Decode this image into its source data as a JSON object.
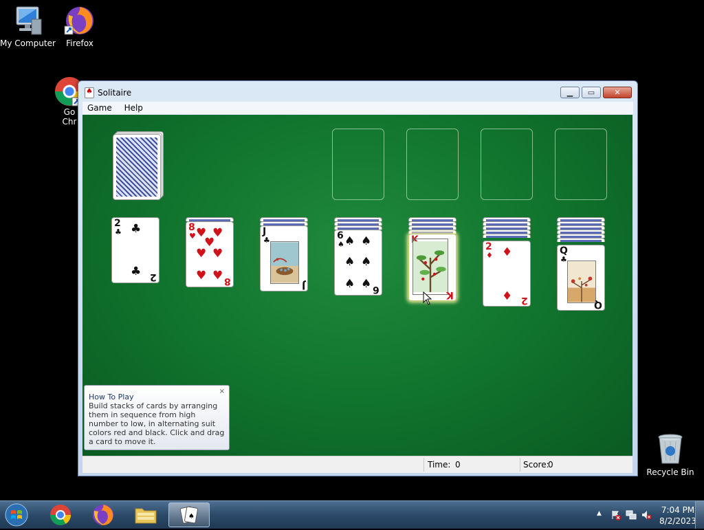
{
  "desktop": {
    "icons": [
      {
        "label": "My Computer"
      },
      {
        "label": "Firefox"
      },
      {
        "label": "Go"
      },
      {
        "label": "Chr"
      },
      {
        "label": "Recycle Bin"
      }
    ]
  },
  "window": {
    "title": "Solitaire",
    "menu": [
      "Game",
      "Help"
    ]
  },
  "game": {
    "stock": "face-down deck",
    "foundations": [
      "empty",
      "empty",
      "empty",
      "empty"
    ],
    "tableau": [
      {
        "top_rank": "2",
        "suit": "♣",
        "color": "black"
      },
      {
        "top_rank": "8",
        "suit": "♥",
        "color": "red"
      },
      {
        "top_rank": "J",
        "suit": "♣",
        "color": "black"
      },
      {
        "top_rank": "6",
        "suit": "♠",
        "color": "black"
      },
      {
        "top_rank": "K",
        "suit": "♥",
        "color": "red"
      },
      {
        "top_rank": "2",
        "suit": "♦",
        "color": "red"
      },
      {
        "top_rank": "Q",
        "suit": "♣",
        "color": "black"
      }
    ]
  },
  "tooltip": {
    "title": "How To Play",
    "body": "Build stacks of cards by arranging them in sequence from high number to low, in alternating suit colors red and black. Click and drag a card to move it.",
    "close": "×"
  },
  "status": {
    "time_label": "Time:",
    "time_value": "0",
    "score_label": "Score:",
    "score_value": "0"
  },
  "tray": {
    "time": "7:04 PM",
    "date": "8/2/2023"
  },
  "colors": {
    "felt": "#10722c",
    "red_suit": "#d0121b"
  }
}
